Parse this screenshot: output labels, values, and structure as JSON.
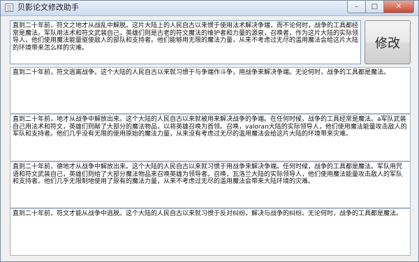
{
  "window": {
    "title": "贝影论文修改助手",
    "caption_buttons": {
      "minimize_icon": "minimize-icon",
      "maximize_icon": "maximize-icon",
      "close_icon": "close-icon",
      "minimize_glyph": "–",
      "maximize_glyph": "□",
      "close_glyph": "✕"
    }
  },
  "modify_button": {
    "label": "修改"
  },
  "texts": [
    "直到二十年前，符文之地才从战乱中解脱。这片大陆上的人民自古以来惯于使用法术解决争端，而不论何时，战争的工具都经常是魔法。军队用法术和符文武装自己，英雄们则是古老的符文魔法的维护者和力量的源泉，召唤者，作为这片大陆的实际领导人，他们使用魔法能量驱使敌人的部队和支持者。他们能够用无限的魔法力量，从来不考虑过无尽的滥用魔法会给这片大陆的环境带来怎么样的灾难。",
    "直到二十年前，符文逃离战争。这个大陆的人民自古以来就习惯于与争端作斗争，用战争来解决争端。无论何时，战争的工具都是魔法。",
    "直到二十年前，地才从战争中解放出来。这个大陆的人民自古以来就被用来解决战争的争端。在任何时候，战争的工具经常是魔法。a军队武装自己用法术和符文，英雄们则献了大部分的魔法物品，以将英雄召唤为首领。召唤，valoran大陆的实际领导人，他们使用魔法能量攻击敌人的军队和支持者。他们几乎没有无限的使用原始的魔法力量，从来没有考虑过无尽的滥用魔法会给这片大陆的环境带来灾难。",
    "直到二十年前，德地才从战争中解放出来。这个大陆的人民自古以来就习惯于用战争来解决争端。任何时候，战争的工具都是魔法。军队用咒语和符文武装自己，英雄们则给了大部分魔法物品来召唤英雄为领导者。召唤，瓦洛兰大陆的实际领导人，他们使用魔法能量攻击敌人的军队和支持者。他们几乎无限制地使用了原有的魔法力量，从来不考虑过无尽的滥用魔法会带来大陆环境的灾难。",
    "直到二十年前，符文才能从战争中逃脱。这个大陆的人民自古以来就习惯于反对纠纷，解决与战争的纠纷。无论何时，战争的工具都是魔法。"
  ]
}
